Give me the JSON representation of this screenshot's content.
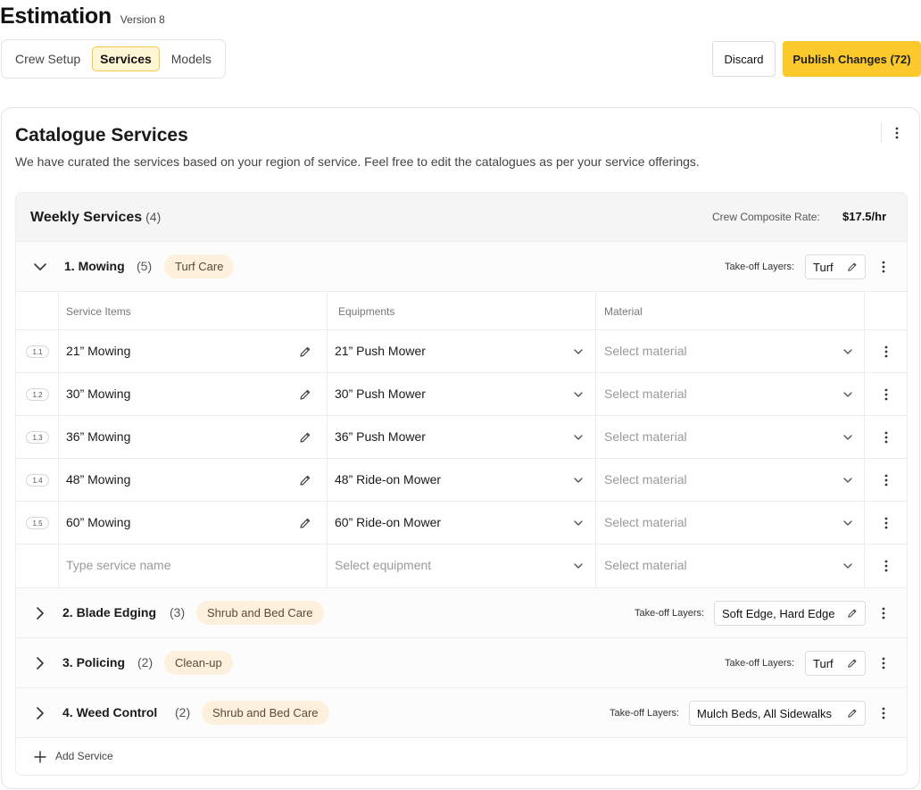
{
  "header": {
    "title": "Estimation",
    "version": "Version 8"
  },
  "tabs": [
    {
      "label": "Crew Setup",
      "active": false
    },
    {
      "label": "Services",
      "active": true
    },
    {
      "label": "Models",
      "active": false
    }
  ],
  "actions": {
    "discard": "Discard",
    "publish": "Publish Changes (72)"
  },
  "catalogue": {
    "title": "Catalogue Services",
    "description": "We have curated the services based on your region of service. Feel free to edit the catalogues as per your service offerings."
  },
  "section": {
    "title": "Weekly Services",
    "count": "(4)",
    "rate_label": "Crew Composite Rate:",
    "rate_value": "$17.5/hr"
  },
  "groups": [
    {
      "name": "1. Mowing",
      "count": "(5)",
      "tag": "Turf Care",
      "layers_label": "Take-off Layers:",
      "layers": "Turf",
      "expanded": true
    },
    {
      "name": "2. Blade Edging",
      "count": "(3)",
      "tag": "Shrub and Bed Care",
      "layers_label": "Take-off Layers:",
      "layers": "Soft Edge, Hard Edge",
      "expanded": false
    },
    {
      "name": "3. Policing",
      "count": "(2)",
      "tag": "Clean-up",
      "layers_label": "Take-off Layers:",
      "layers": "Turf",
      "expanded": false
    },
    {
      "name": "4. Weed Control",
      "count": "(2)",
      "tag": "Shrub and Bed Care",
      "layers_label": "Take-off Layers:",
      "layers": "Mulch Beds, All Sidewalks",
      "expanded": false
    }
  ],
  "table": {
    "columns": [
      "Service Items",
      "Equipments",
      "Material"
    ],
    "rows": [
      {
        "num": "1.1",
        "item": "21” Mowing",
        "equipment": "21” Push Mower",
        "material": "Select material"
      },
      {
        "num": "1.2",
        "item": "30” Mowing",
        "equipment": "30” Push Mower",
        "material": "Select material"
      },
      {
        "num": "1.3",
        "item": "36” Mowing",
        "equipment": "36” Push Mower",
        "material": "Select material"
      },
      {
        "num": "1.4",
        "item": "48” Mowing",
        "equipment": "48” Ride-on Mower",
        "material": "Select material"
      },
      {
        "num": "1.5",
        "item": "60” Mowing",
        "equipment": "60” Ride-on Mower",
        "material": "Select material"
      }
    ],
    "new_row": {
      "item_placeholder": "Type service name",
      "equipment_placeholder": "Select equipment",
      "material_placeholder": "Select material"
    }
  },
  "add_service": "Add Service",
  "icons": {
    "expand": "chevron-down-icon",
    "collapse": "chevron-right-icon",
    "edit": "pencil-icon",
    "menu": "more-vertical-icon",
    "dropdown": "chevron-down-icon",
    "add": "plus-icon"
  },
  "colors": {
    "accent": "#fcc92c",
    "tag_bg": "#fdf0dc",
    "active_tab_bg": "#fff6d3"
  }
}
